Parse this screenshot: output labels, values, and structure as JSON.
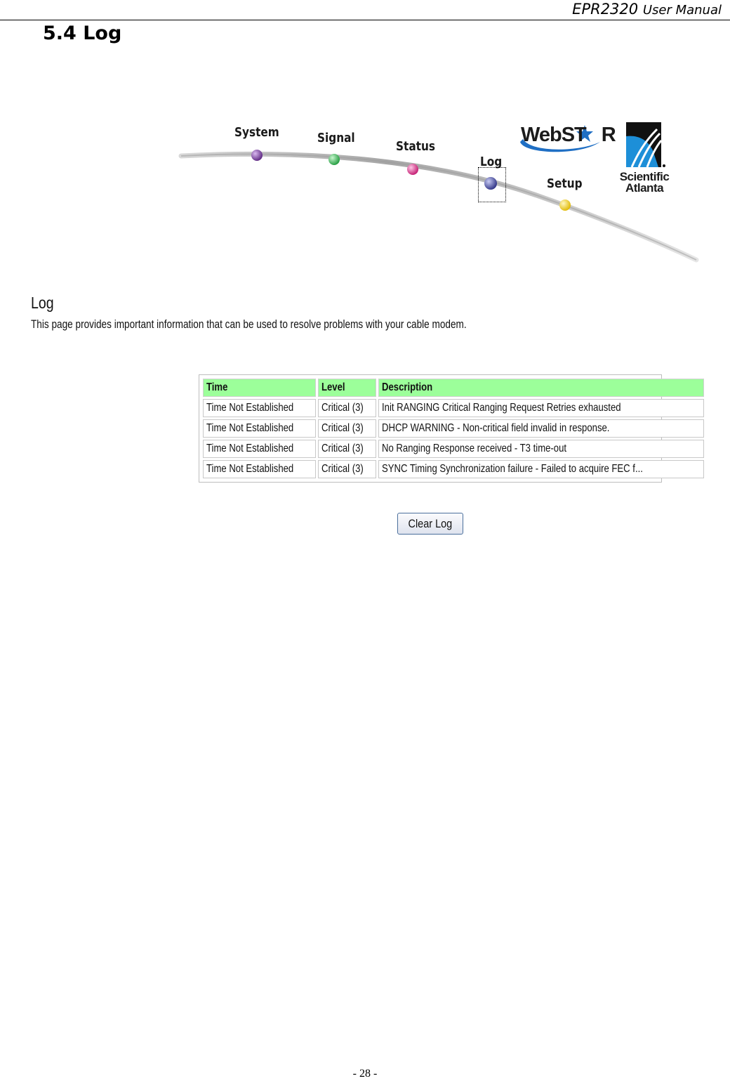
{
  "doc_header": {
    "model": "EPR2320",
    "title_rest": "User Manual"
  },
  "section": {
    "title": "5.4 Log"
  },
  "nav": {
    "items": [
      {
        "label": "System",
        "color": "#7b3f9e"
      },
      {
        "label": "Signal",
        "color": "#3cc25a"
      },
      {
        "label": "Status",
        "color": "#e0409a"
      },
      {
        "label": "Log",
        "color": "#4a4fa8",
        "selected": true
      },
      {
        "label": "Setup",
        "color": "#f2d21e"
      }
    ],
    "brand_logo": "WebSTAR",
    "brand_logo_text_a": "WebST",
    "brand_logo_text_b": "R",
    "company_line1": "Scientific",
    "company_line2": "Atlanta"
  },
  "page": {
    "heading": "Log",
    "description": "This page provides important information that can be used to resolve problems with your cable modem."
  },
  "log_table": {
    "header_color": "#9cff9a",
    "columns": [
      "Time",
      "Level",
      "Description"
    ],
    "rows": [
      {
        "time": "Time Not Established",
        "level": "Critical (3)",
        "description": "Init RANGING Critical Ranging Request Retries exhausted"
      },
      {
        "time": "Time Not Established",
        "level": "Critical (3)",
        "description": "DHCP WARNING - Non-critical field invalid in response."
      },
      {
        "time": "Time Not Established",
        "level": "Critical (3)",
        "description": "No Ranging Response received - T3 time-out"
      },
      {
        "time": "Time Not Established",
        "level": "Critical (3)",
        "description": "SYNC Timing Synchronization failure - Failed to acquire FEC f..."
      }
    ]
  },
  "actions": {
    "clear_log_label": "Clear Log"
  },
  "footer": {
    "page_number": "- 28 -"
  }
}
